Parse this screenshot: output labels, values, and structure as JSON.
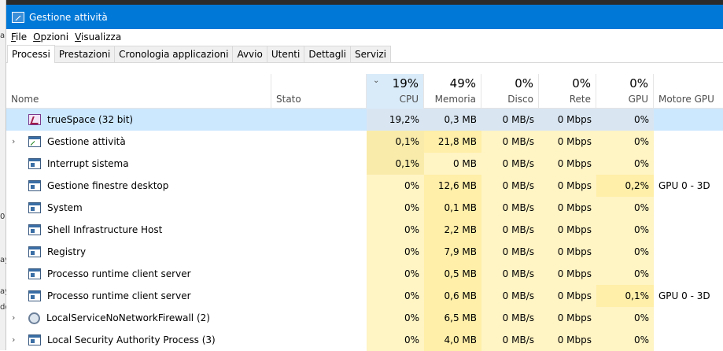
{
  "window": {
    "title": "Gestione attività"
  },
  "menu": [
    "File",
    "Opzioni",
    "Visualizza"
  ],
  "tabs": [
    {
      "label": "Processi",
      "active": true
    },
    {
      "label": "Prestazioni",
      "active": false
    },
    {
      "label": "Cronologia applicazioni",
      "active": false
    },
    {
      "label": "Avvio",
      "active": false
    },
    {
      "label": "Utenti",
      "active": false
    },
    {
      "label": "Dettagli",
      "active": false
    },
    {
      "label": "Servizi",
      "active": false
    }
  ],
  "columns": {
    "name": "Nome",
    "stato": "Stato",
    "cpu": {
      "label": "CPU",
      "pct": "19%"
    },
    "mem": {
      "label": "Memoria",
      "pct": "49%"
    },
    "disk": {
      "label": "Disco",
      "pct": "0%"
    },
    "net": {
      "label": "Rete",
      "pct": "0%"
    },
    "gpu": {
      "label": "GPU",
      "pct": "0%"
    },
    "gpuengine": {
      "label": "Motore GPU"
    }
  },
  "rows": [
    {
      "name": "trueSpace (32 bit)",
      "icon": "truespace-icon",
      "expandable": false,
      "selected": true,
      "cpu": "19,2%",
      "mem": "0,3 MB",
      "disk": "0 MB/s",
      "net": "0 Mbps",
      "gpu": "0%",
      "gpuengine": ""
    },
    {
      "name": "Gestione attività",
      "icon": "task-manager-icon",
      "expandable": true,
      "selected": false,
      "cpu": "0,1%",
      "mem": "21,8 MB",
      "disk": "0 MB/s",
      "net": "0 Mbps",
      "gpu": "0%",
      "gpuengine": ""
    },
    {
      "name": "Interrupt sistema",
      "icon": "window-icon",
      "expandable": false,
      "selected": false,
      "cpu": "0,1%",
      "mem": "0 MB",
      "disk": "0 MB/s",
      "net": "0 Mbps",
      "gpu": "0%",
      "gpuengine": ""
    },
    {
      "name": "Gestione finestre desktop",
      "icon": "window-icon",
      "expandable": false,
      "selected": false,
      "cpu": "0%",
      "mem": "12,6 MB",
      "disk": "0 MB/s",
      "net": "0 Mbps",
      "gpu": "0,2%",
      "gpuengine": "GPU 0 - 3D"
    },
    {
      "name": "System",
      "icon": "window-icon",
      "expandable": false,
      "selected": false,
      "cpu": "0%",
      "mem": "0,1 MB",
      "disk": "0 MB/s",
      "net": "0 Mbps",
      "gpu": "0%",
      "gpuengine": ""
    },
    {
      "name": "Shell Infrastructure Host",
      "icon": "window-icon",
      "expandable": false,
      "selected": false,
      "cpu": "0%",
      "mem": "2,2 MB",
      "disk": "0 MB/s",
      "net": "0 Mbps",
      "gpu": "0%",
      "gpuengine": ""
    },
    {
      "name": "Registry",
      "icon": "window-icon",
      "expandable": false,
      "selected": false,
      "cpu": "0%",
      "mem": "7,9 MB",
      "disk": "0 MB/s",
      "net": "0 Mbps",
      "gpu": "0%",
      "gpuengine": ""
    },
    {
      "name": "Processo runtime client server",
      "icon": "window-icon",
      "expandable": false,
      "selected": false,
      "cpu": "0%",
      "mem": "0,5 MB",
      "disk": "0 MB/s",
      "net": "0 Mbps",
      "gpu": "0%",
      "gpuengine": ""
    },
    {
      "name": "Processo runtime client server",
      "icon": "window-icon",
      "expandable": false,
      "selected": false,
      "cpu": "0%",
      "mem": "0,6 MB",
      "disk": "0 MB/s",
      "net": "0 Mbps",
      "gpu": "0,1%",
      "gpuengine": "GPU 0 - 3D"
    },
    {
      "name": "LocalServiceNoNetworkFirewall (2)",
      "icon": "gear-icon",
      "expandable": true,
      "selected": false,
      "cpu": "0%",
      "mem": "6,5 MB",
      "disk": "0 MB/s",
      "net": "0 Mbps",
      "gpu": "0%",
      "gpuengine": ""
    },
    {
      "name": "Local Security Authority Process (3)",
      "icon": "window-icon",
      "expandable": true,
      "selected": false,
      "cpu": "0%",
      "mem": "4,0 MB",
      "disk": "0 MB/s",
      "net": "0 Mbps",
      "gpu": "0%",
      "gpuengine": ""
    }
  ],
  "background_strip": [
    "a",
    "0",
    "ay",
    "ay",
    "do"
  ]
}
